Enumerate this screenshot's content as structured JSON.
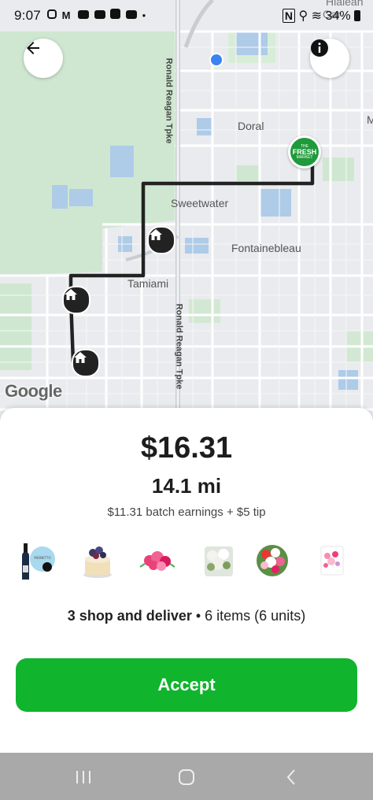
{
  "status_bar": {
    "time": "9:07",
    "left_icons": [
      "instagram-icon",
      "gmail-icon",
      "youtube-icon",
      "youtube-icon",
      "app-icon",
      "youtube-icon",
      "dot-icon"
    ],
    "right_icons": [
      "nfc-icon",
      "location-icon",
      "wifi-icon",
      "signal-icon"
    ],
    "battery": "34%"
  },
  "map": {
    "labels": {
      "doral": "Doral",
      "sweetwater": "Sweetwater",
      "fontainebleau": "Fontainebleau",
      "tamiami": "Tamiami",
      "hialeah": "Hialeah",
      "gardens": "Gar",
      "m_edge": "M"
    },
    "roads": {
      "top": "Ronald Reagan Tpke",
      "bottom": "Ronald Reagan Tpke"
    },
    "attribution": "Google",
    "store_logo": {
      "line1": "THE",
      "line2": "FRESH",
      "line3": "MARKET",
      "color": "#1f9a3b"
    },
    "route_color": "#222222"
  },
  "offer": {
    "price": "$16.31",
    "distance": "14.1 mi",
    "earnings": "$11.31 batch earnings + $5 tip",
    "summary_bold": "3 shop and deliver",
    "summary_rest": " • 6 items (6 units)",
    "accept_label": "Accept",
    "accent": "#10b42d",
    "items": [
      "wine-bottle",
      "cake",
      "pink-flowers",
      "white-flowers",
      "mixed-bouquet",
      "gift-card"
    ]
  },
  "nav": {
    "recent": "recent-apps-icon",
    "home": "home-icon",
    "back": "back-icon"
  }
}
